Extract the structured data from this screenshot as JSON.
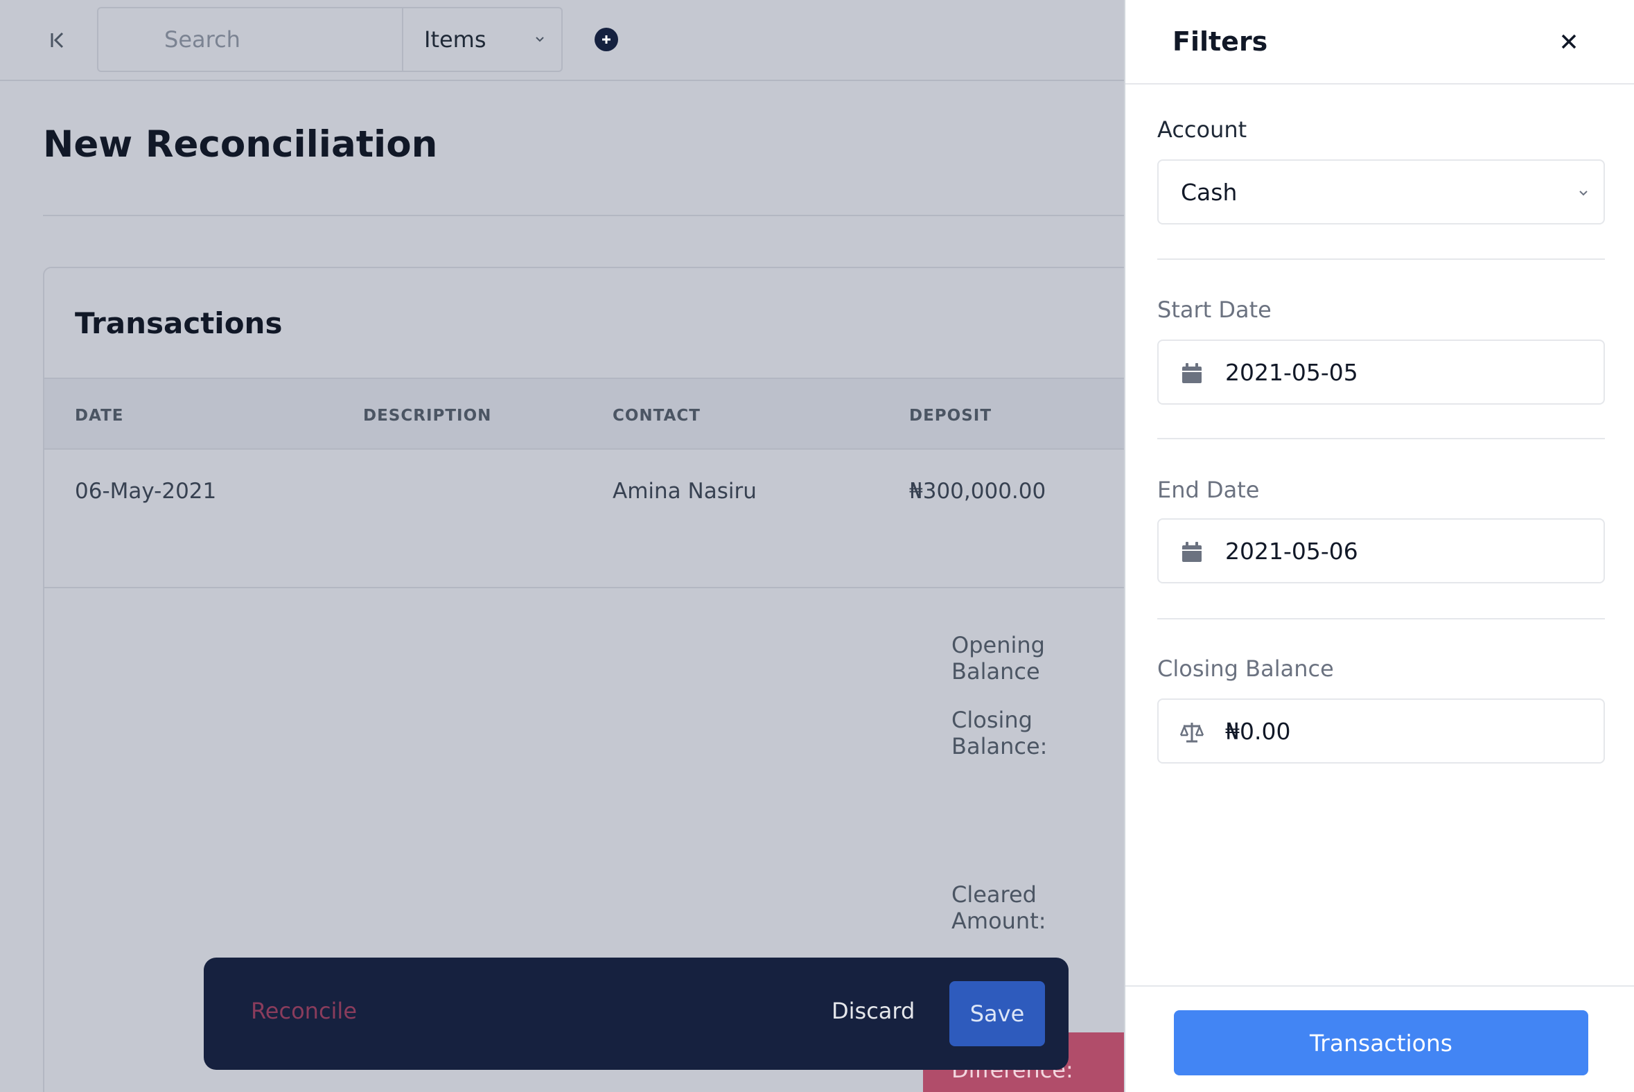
{
  "topbar": {
    "search_placeholder": "Search",
    "search_scope": "Items"
  },
  "page": {
    "title": "New Reconciliation"
  },
  "transactions": {
    "title": "Transactions",
    "columns": [
      "DATE",
      "DESCRIPTION",
      "CONTACT",
      "DEPOSIT"
    ],
    "rows": [
      {
        "date": "06-May-2021",
        "description": "",
        "contact": "Amina Nasiru",
        "deposit": "₦300,000.00"
      }
    ],
    "totals": {
      "opening_balance_label": "Opening Balance",
      "closing_balance_label": "Closing Balance:",
      "cleared_amount_label": "Cleared Amount:",
      "difference_label": "Difference:"
    }
  },
  "action_bar": {
    "reconcile_label": "Reconcile",
    "discard_label": "Discard",
    "save_label": "Save"
  },
  "filters": {
    "title": "Filters",
    "account_label": "Account",
    "account_value": "Cash",
    "start_date_label": "Start Date",
    "start_date_value": "2021-05-05",
    "end_date_label": "End Date",
    "end_date_value": "2021-05-06",
    "closing_balance_label": "Closing Balance",
    "closing_balance_value": "₦0.00",
    "submit_label": "Transactions"
  },
  "icons": {
    "collapse": "collapse-left-icon",
    "add": "plus-circle-icon",
    "close": "close-icon",
    "calendar": "calendar-icon",
    "balance": "balance-scale-icon",
    "chevron": "chevron-down-icon"
  },
  "colors": {
    "primary_button": "#4285f4",
    "save_button": "#2e5bbd",
    "action_bar_bg": "#16213f",
    "difference_bg": "#b14d6a",
    "overlay_bg": "#c5c8d1"
  }
}
